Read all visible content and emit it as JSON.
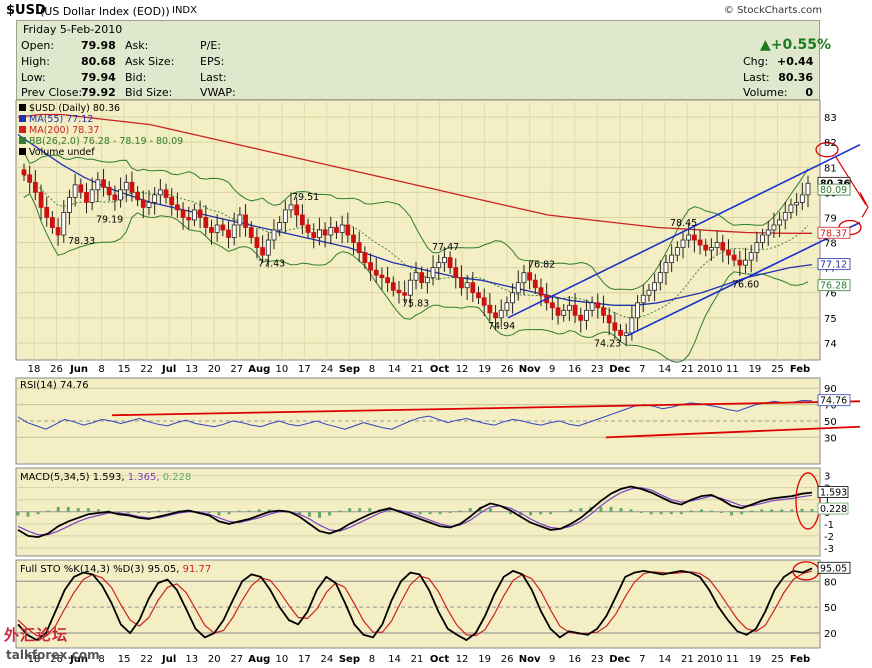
{
  "header": {
    "symbol": "$USD",
    "name": "(US Dollar Index (EOD))",
    "exchange": "INDX",
    "copyright": "© StockCharts.com"
  },
  "quote": {
    "date": "Friday   5-Feb-2010",
    "open_label": "Open:",
    "open": "79.98",
    "high_label": "High:",
    "high": "80.68",
    "low_label": "Low:",
    "low": "79.94",
    "prev_label": "Prev Close:",
    "prev": "79.92",
    "ask_label": "Ask:",
    "asksize_label": "Ask Size:",
    "bid_label": "Bid:",
    "bidsize_label": "Bid Size:",
    "pe_label": "P/E:",
    "eps_label": "EPS:",
    "last_label": "Last:",
    "vwap_label": "VWAP:",
    "pct_change": "▲+0.55%",
    "chg_label": "Chg:",
    "chg": "+0.44",
    "last2_label": "Last:",
    "last": "80.36",
    "volume_label": "Volume:",
    "volume": "0"
  },
  "colors": {
    "up": "#1e7a1e",
    "down": "#cc1111",
    "ma55": "#2233aa",
    "ma200": "#cc2222",
    "bb": "#2f7d2f",
    "panel_bg": "#f3eec4",
    "quote_bg": "#dfe7cd",
    "channel": "#1a2ed0",
    "annot": "#dd0000"
  },
  "chart_data": [
    {
      "type": "candlestick",
      "title": "$USD (Daily) 80.36",
      "legend": [
        {
          "name": "$USD (Daily) 80.36"
        },
        {
          "name": "MA(55) 77.12"
        },
        {
          "name": "MA(200) 78.37"
        },
        {
          "name": "BB(26,2.0) 76.28 - 78.19 - 80.09"
        },
        {
          "name": "Volume undef"
        }
      ],
      "ylim": [
        73.4,
        83.6
      ],
      "y_ticks": [
        "74",
        "75",
        "76",
        "77",
        "78",
        "79",
        "80",
        "81",
        "82",
        "83"
      ],
      "x_ticks": [
        "18",
        "26",
        "Jun",
        "8",
        "15",
        "22",
        "Jul",
        "13",
        "20",
        "27",
        "Aug",
        "10",
        "17",
        "24",
        "Sep",
        "8",
        "14",
        "21",
        "Oct",
        "12",
        "19",
        "26",
        "Nov",
        "9",
        "16",
        "23",
        "Dec",
        "7",
        "14",
        "21",
        "2010",
        "11",
        "19",
        "25",
        "Feb"
      ],
      "price_labels": [
        "78.33",
        "79.19",
        "79.51",
        "77.43",
        "75.83",
        "77.47",
        "74.94",
        "76.82",
        "74.23",
        "78.45",
        "76.60"
      ],
      "right_tags": [
        "80.36",
        "80.09",
        "78.37",
        "77.12",
        "76.28"
      ],
      "close_series": [
        80.7,
        80.4,
        80.0,
        79.4,
        79.0,
        78.6,
        78.3,
        79.2,
        79.8,
        80.3,
        80.0,
        79.6,
        80.1,
        80.5,
        80.2,
        79.9,
        79.7,
        80.1,
        80.4,
        80.0,
        79.7,
        79.4,
        79.6,
        79.9,
        80.1,
        79.8,
        79.5,
        79.3,
        79.0,
        78.9,
        79.3,
        79.0,
        78.6,
        78.4,
        78.7,
        78.5,
        78.2,
        78.7,
        79.1,
        78.6,
        78.2,
        77.8,
        77.5,
        78.1,
        78.5,
        78.8,
        79.3,
        79.5,
        79.1,
        78.7,
        78.4,
        78.2,
        78.5,
        78.3,
        78.6,
        78.4,
        78.7,
        78.3,
        78.0,
        77.6,
        77.2,
        76.9,
        76.7,
        76.6,
        76.4,
        76.1,
        76.0,
        75.9,
        76.5,
        76.8,
        76.4,
        76.6,
        77.0,
        77.2,
        77.4,
        77.0,
        76.6,
        76.2,
        76.4,
        76.0,
        75.8,
        75.5,
        75.2,
        75.0,
        75.3,
        75.6,
        76.0,
        76.4,
        76.8,
        76.5,
        76.2,
        75.9,
        75.6,
        75.4,
        75.1,
        75.3,
        75.5,
        75.1,
        74.9,
        75.3,
        75.6,
        75.4,
        75.1,
        74.8,
        74.5,
        74.3,
        74.4,
        75.0,
        75.6,
        75.9,
        76.1,
        76.4,
        76.8,
        77.2,
        77.5,
        77.8,
        78.1,
        78.3,
        78.1,
        77.9,
        77.7,
        77.8,
        78.0,
        77.7,
        77.5,
        77.3,
        77.1,
        77.3,
        77.6,
        78.0,
        78.3,
        78.5,
        78.7,
        78.9,
        79.2,
        79.5,
        79.6,
        79.9,
        80.36
      ],
      "ma55_series": [
        82.3,
        81.7,
        81.1,
        80.6,
        80.2,
        79.9,
        79.6,
        79.4,
        79.2,
        79.0,
        78.8,
        78.6,
        78.4,
        78.2,
        78.0,
        77.8,
        77.5,
        77.2,
        77.0,
        76.8,
        76.6,
        76.5,
        76.3,
        76.1,
        75.9,
        75.7,
        75.6,
        75.5,
        75.5,
        75.6,
        75.8,
        76.0,
        76.3,
        76.6,
        76.8,
        77.0,
        77.12
      ],
      "ma200_series": [
        83.0,
        83.1,
        83.1,
        83.0,
        82.9,
        82.8,
        82.7,
        82.5,
        82.3,
        82.1,
        81.9,
        81.7,
        81.5,
        81.3,
        81.1,
        80.9,
        80.7,
        80.5,
        80.3,
        80.1,
        79.9,
        79.7,
        79.5,
        79.3,
        79.1,
        79.0,
        78.9,
        78.8,
        78.7,
        78.6,
        78.55,
        78.5,
        78.45,
        78.4,
        78.38,
        78.37,
        78.37
      ]
    },
    {
      "type": "line",
      "title": "RSI(14) 74.76",
      "ylim": [
        0,
        100
      ],
      "y_ticks": [
        "90",
        "70",
        "50",
        "30"
      ],
      "right_tags": [
        "74.76"
      ],
      "values": [
        55,
        48,
        44,
        40,
        46,
        52,
        49,
        45,
        48,
        52,
        50,
        47,
        50,
        53,
        49,
        46,
        44,
        48,
        51,
        47,
        45,
        43,
        46,
        50,
        48,
        45,
        43,
        47,
        50,
        46,
        44,
        47,
        50,
        46,
        43,
        40,
        44,
        48,
        45,
        42,
        40,
        45,
        50,
        54,
        56,
        52,
        48,
        51,
        53,
        50,
        47,
        45,
        49,
        52,
        50,
        47,
        45,
        48,
        50,
        46,
        44,
        48,
        52,
        56,
        60,
        64,
        68,
        70,
        68,
        65,
        67,
        70,
        72,
        71,
        69,
        67,
        64,
        62,
        66,
        70,
        72,
        74,
        72,
        73,
        75,
        74.76
      ]
    },
    {
      "type": "line",
      "title": "MACD(5,34,5) 1.593, 1.365, 0.228",
      "series_names": [
        "MACD(5,34,5) 1.593",
        "1.365",
        "0.228"
      ],
      "ylim": [
        -3.5,
        3.3
      ],
      "y_ticks": [
        "3",
        "2",
        "1",
        "0",
        "-1",
        "-2",
        "-3"
      ],
      "right_tags": [
        "1.593",
        "0.228"
      ],
      "macd": [
        -1.5,
        -2.0,
        -2.1,
        -1.8,
        -1.2,
        -0.8,
        -0.5,
        -0.2,
        -0.1,
        0.0,
        -0.2,
        -0.3,
        -0.5,
        -0.6,
        -0.4,
        -0.2,
        0.0,
        0.1,
        -0.1,
        -0.3,
        -0.8,
        -1.0,
        -0.8,
        -0.6,
        -0.3,
        0.0,
        0.1,
        0.0,
        -0.4,
        -1.0,
        -1.6,
        -1.8,
        -1.5,
        -1.0,
        -0.6,
        -0.2,
        0.1,
        0.3,
        0.0,
        -0.3,
        -0.6,
        -0.9,
        -1.2,
        -1.3,
        -1.0,
        -0.4,
        0.3,
        0.7,
        0.5,
        0.1,
        -0.4,
        -0.9,
        -1.2,
        -1.5,
        -1.4,
        -1.0,
        -0.5,
        0.2,
        0.9,
        1.5,
        1.9,
        2.1,
        1.9,
        1.6,
        1.2,
        0.8,
        0.6,
        1.0,
        1.3,
        1.4,
        1.0,
        0.5,
        0.3,
        0.6,
        0.9,
        1.1,
        1.2,
        1.3,
        1.5,
        1.593
      ],
      "signal": [
        -1.2,
        -1.6,
        -1.9,
        -1.9,
        -1.6,
        -1.2,
        -0.8,
        -0.5,
        -0.3,
        -0.1,
        -0.1,
        -0.2,
        -0.4,
        -0.5,
        -0.5,
        -0.3,
        -0.1,
        0.0,
        0.0,
        -0.2,
        -0.5,
        -0.8,
        -0.9,
        -0.7,
        -0.5,
        -0.2,
        0.0,
        0.0,
        -0.2,
        -0.6,
        -1.1,
        -1.5,
        -1.6,
        -1.3,
        -0.9,
        -0.5,
        -0.1,
        0.2,
        0.1,
        -0.1,
        -0.4,
        -0.7,
        -1.0,
        -1.2,
        -1.1,
        -0.7,
        -0.1,
        0.4,
        0.5,
        0.3,
        -0.1,
        -0.6,
        -1.0,
        -1.3,
        -1.4,
        -1.2,
        -0.8,
        -0.2,
        0.5,
        1.1,
        1.6,
        1.9,
        2.0,
        1.8,
        1.4,
        1.0,
        0.8,
        0.9,
        1.1,
        1.3,
        1.1,
        0.8,
        0.5,
        0.5,
        0.7,
        0.9,
        1.0,
        1.1,
        1.25,
        1.365
      ]
    },
    {
      "type": "line",
      "title": "Full STO %K(14,3) %D(3) 95.05, 91.77",
      "series_names": [
        "Full STO %K(14,3) %D(3) 95.05",
        "91.77"
      ],
      "ylim": [
        5,
        100
      ],
      "y_ticks": [
        "80",
        "50",
        "20"
      ],
      "right_tags": [
        "95.05"
      ],
      "k": [
        30,
        18,
        12,
        20,
        45,
        70,
        85,
        90,
        88,
        75,
        55,
        30,
        20,
        35,
        60,
        78,
        82,
        70,
        48,
        25,
        15,
        20,
        35,
        58,
        80,
        88,
        85,
        70,
        50,
        35,
        30,
        45,
        70,
        85,
        78,
        55,
        30,
        18,
        15,
        30,
        58,
        80,
        90,
        88,
        70,
        45,
        25,
        18,
        12,
        20,
        40,
        65,
        85,
        92,
        88,
        70,
        45,
        25,
        15,
        22,
        20,
        18,
        25,
        40,
        62,
        85,
        90,
        92,
        90,
        88,
        90,
        92,
        90,
        85,
        70,
        50,
        35,
        22,
        18,
        25,
        45,
        70,
        85,
        92,
        90,
        95.05
      ],
      "d": [
        35,
        25,
        17,
        17,
        28,
        48,
        67,
        82,
        88,
        84,
        73,
        53,
        35,
        28,
        38,
        58,
        73,
        77,
        67,
        48,
        29,
        20,
        23,
        38,
        58,
        75,
        84,
        81,
        68,
        52,
        38,
        37,
        48,
        67,
        78,
        73,
        54,
        34,
        21,
        21,
        34,
        56,
        76,
        86,
        83,
        68,
        47,
        29,
        18,
        17,
        24,
        42,
        63,
        81,
        88,
        83,
        68,
        47,
        28,
        21,
        19,
        20,
        21,
        28,
        42,
        62,
        79,
        89,
        91,
        90,
        89,
        90,
        91,
        89,
        82,
        68,
        52,
        36,
        25,
        22,
        29,
        47,
        67,
        82,
        89,
        91.77
      ]
    }
  ],
  "watermark": {
    "cn": "外汇论坛",
    "en": "talkforex.com"
  }
}
